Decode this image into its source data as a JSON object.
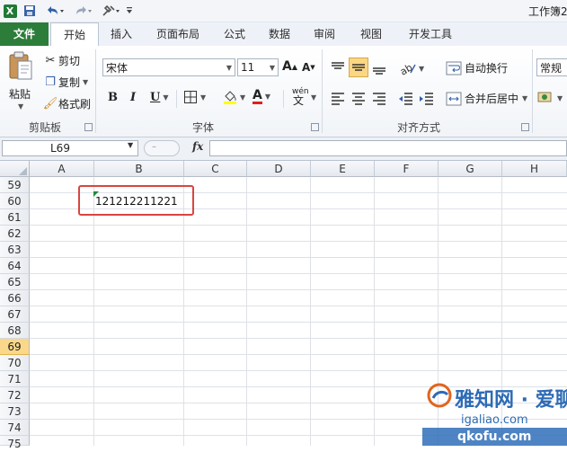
{
  "title_bar": {
    "app_title": "工作簿2.",
    "excel_icon_letter": "X"
  },
  "ribbon_tabs": [
    {
      "id": "file",
      "label": "文件"
    },
    {
      "id": "home",
      "label": "开始"
    },
    {
      "id": "insert",
      "label": "插入"
    },
    {
      "id": "page_layout",
      "label": "页面布局"
    },
    {
      "id": "formulas",
      "label": "公式"
    },
    {
      "id": "data",
      "label": "数据"
    },
    {
      "id": "review",
      "label": "审阅"
    },
    {
      "id": "view",
      "label": "视图"
    },
    {
      "id": "developer",
      "label": "开发工具"
    }
  ],
  "clipboard": {
    "paste_label": "粘贴",
    "cut_label": "剪切",
    "copy_label": "复制",
    "format_painter_label": "格式刷",
    "group_label": "剪贴板"
  },
  "font": {
    "font_name": "宋体",
    "font_size": "11",
    "bold": "B",
    "italic": "I",
    "underline": "U",
    "grow": "A",
    "shrink": "A",
    "font_color_glyph": "A",
    "phonetic_glyph": "wén",
    "group_label": "字体"
  },
  "alignment": {
    "wrap_text_label": "自动换行",
    "merge_center_label": "合并后居中",
    "group_label": "对齐方式"
  },
  "number": {
    "format_value": "常规"
  },
  "formula_bar": {
    "name_box_value": "L69",
    "fx_label": "fx",
    "formula_value": ""
  },
  "sheet": {
    "columns": [
      "A",
      "B",
      "C",
      "D",
      "E",
      "F",
      "G",
      "H"
    ],
    "rows": [
      "59",
      "60",
      "61",
      "62",
      "63",
      "64",
      "65",
      "66",
      "67",
      "68",
      "69",
      "70",
      "71",
      "72",
      "73",
      "74",
      "75"
    ],
    "selected_row": "69",
    "cell_b60_value": "121212211221"
  },
  "watermark": {
    "line1": "雅知网 · 爱聊",
    "line2": "igaliao.com",
    "line3": "qkofu.com"
  },
  "colors": {
    "file_tab": "#2d7d3a",
    "highlight_border": "#d9453f",
    "selected_row_header": "#f9d88a",
    "text_marker": "#1f8a3b"
  }
}
